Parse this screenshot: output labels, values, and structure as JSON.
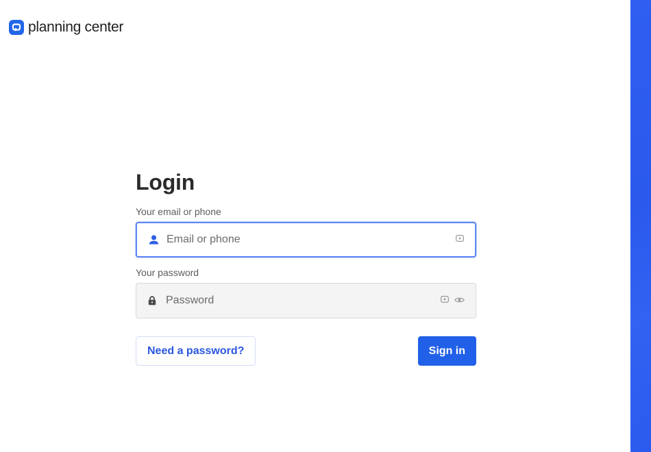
{
  "brand": {
    "name": "planning center",
    "icon": "planning-center-logo-icon",
    "color": "#2266ea"
  },
  "login": {
    "title": "Login",
    "email": {
      "label": "Your email or phone",
      "placeholder": "Email or phone",
      "value": "",
      "lead_icon": "person-icon",
      "trail_icons": [
        "password-manager-icon"
      ]
    },
    "password": {
      "label": "Your password",
      "placeholder": "Password",
      "value": "",
      "lead_icon": "lock-icon",
      "trail_icons": [
        "password-manager-icon",
        "eye-icon"
      ]
    },
    "need_password_label": "Need a password?",
    "sign_in_label": "Sign in"
  },
  "colors": {
    "accent": "#2160e8",
    "side_panel": "#2f5ef0",
    "focus_ring": "#5f87f3"
  }
}
